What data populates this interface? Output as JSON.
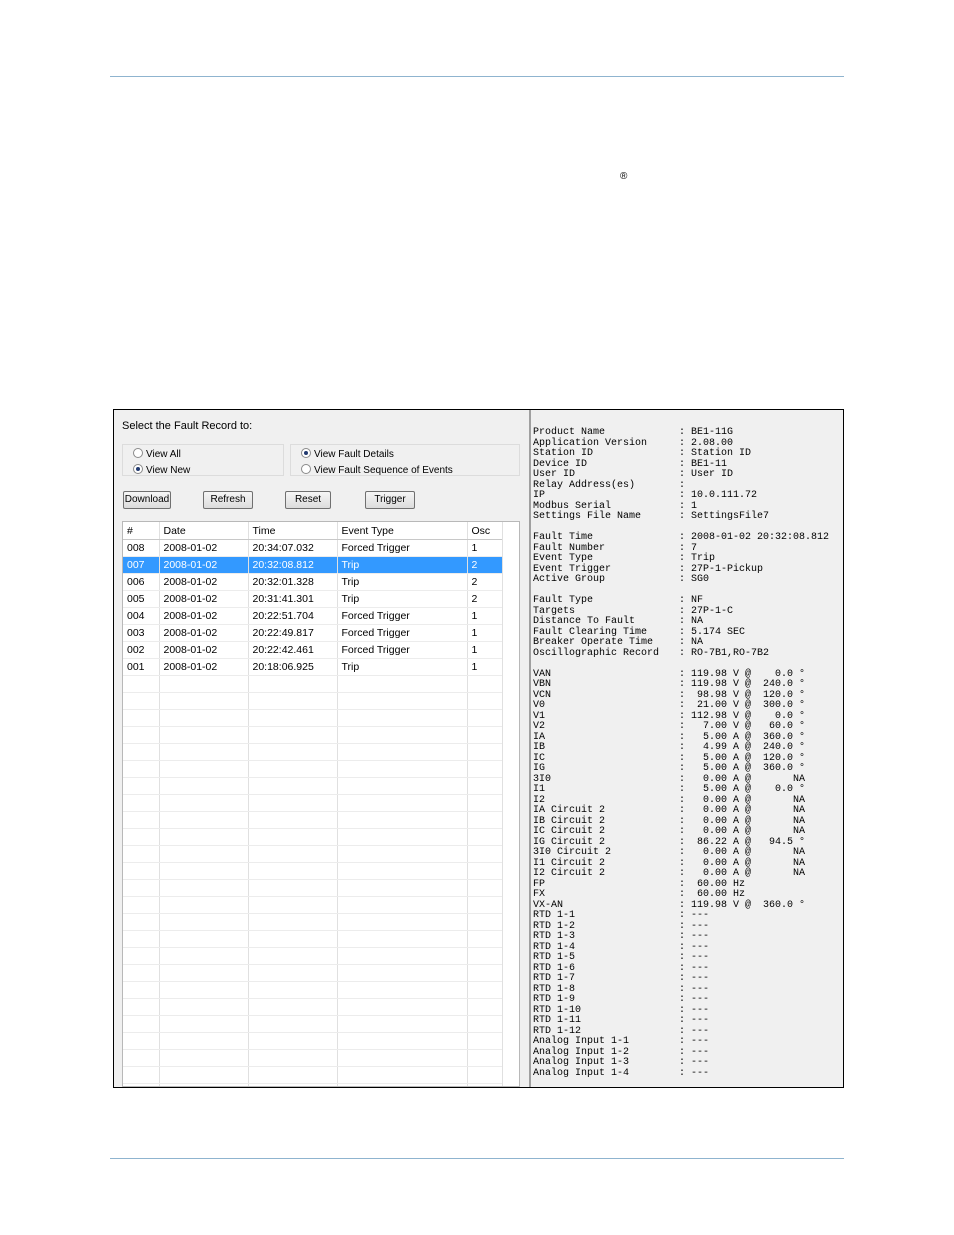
{
  "page": {
    "registered_mark": "®"
  },
  "dialog": {
    "prompt": "Select the Fault Record to:",
    "view_options": [
      {
        "label": "View All",
        "selected": false
      },
      {
        "label": "View New",
        "selected": true
      }
    ],
    "detail_options": [
      {
        "label": "View Fault Details",
        "selected": true
      },
      {
        "label": "View Fault Sequence of Events",
        "selected": false
      }
    ],
    "buttons": {
      "download": "Download",
      "refresh": "Refresh",
      "reset": "Reset",
      "trigger": "Trigger"
    },
    "table": {
      "headers": [
        "#",
        "Date",
        "Time",
        "Event Type",
        "Osc"
      ],
      "rows": [
        [
          "008",
          "2008-01-02",
          "20:34:07.032",
          "Forced Trigger",
          "1"
        ],
        [
          "007",
          "2008-01-02",
          "20:32:08.812",
          "Trip",
          "2"
        ],
        [
          "006",
          "2008-01-02",
          "20:32:01.328",
          "Trip",
          "2"
        ],
        [
          "005",
          "2008-01-02",
          "20:31:41.301",
          "Trip",
          "2"
        ],
        [
          "004",
          "2008-01-02",
          "20:22:51.704",
          "Forced Trigger",
          "1"
        ],
        [
          "003",
          "2008-01-02",
          "20:22:49.817",
          "Forced Trigger",
          "1"
        ],
        [
          "002",
          "2008-01-02",
          "20:22:42.461",
          "Forced Trigger",
          "1"
        ],
        [
          "001",
          "2008-01-02",
          "20:18:06.925",
          "Trip",
          "1"
        ]
      ],
      "selected_row": "007"
    }
  },
  "report": {
    "sections": [
      [
        [
          "Product Name",
          ": BE1-11G"
        ],
        [
          "Application Version",
          ": 2.08.00"
        ],
        [
          "Station ID",
          ": Station ID"
        ],
        [
          "Device ID",
          ": BE1-11"
        ],
        [
          "User ID",
          ": User ID"
        ],
        [
          "Relay Address(es)",
          ":"
        ],
        [
          "IP",
          ": 10.0.111.72"
        ],
        [
          "Modbus Serial",
          ": 1"
        ],
        [
          "Settings File Name",
          ": SettingsFile7"
        ]
      ],
      [
        [
          "Fault Time",
          ": 2008-01-02 20:32:08.812"
        ],
        [
          "Fault Number",
          ": 7"
        ],
        [
          "Event Type",
          ": Trip"
        ],
        [
          "Event Trigger",
          ": 27P-1-Pickup"
        ],
        [
          "Active Group",
          ": SG0"
        ]
      ],
      [
        [
          "Fault Type",
          ": NF"
        ],
        [
          "Targets",
          ": 27P-1-C"
        ],
        [
          "Distance To Fault",
          ": NA"
        ],
        [
          "Fault Clearing Time",
          ": 5.174 SEC"
        ],
        [
          "Breaker Operate Time",
          ": NA"
        ],
        [
          "Oscillographic Record",
          ": RO-7B1,RO-7B2"
        ]
      ],
      [
        [
          "VAN",
          ": 119.98 V @    0.0 °"
        ],
        [
          "VBN",
          ": 119.98 V @  240.0 °"
        ],
        [
          "VCN",
          ":  98.98 V @  120.0 °"
        ],
        [
          "V0",
          ":  21.00 V @  300.0 °"
        ],
        [
          "V1",
          ": 112.98 V @    0.0 °"
        ],
        [
          "V2",
          ":   7.00 V @   60.0 °"
        ],
        [
          "IA",
          ":   5.00 A @  360.0 °"
        ],
        [
          "IB",
          ":   4.99 A @  240.0 °"
        ],
        [
          "IC",
          ":   5.00 A @  120.0 °"
        ],
        [
          "IG",
          ":   5.00 A @  360.0 °"
        ],
        [
          "3I0",
          ":   0.00 A @       NA"
        ],
        [
          "I1",
          ":   5.00 A @    0.0 °"
        ],
        [
          "I2",
          ":   0.00 A @       NA"
        ],
        [
          "IA Circuit 2",
          ":   0.00 A @       NA"
        ],
        [
          "IB Circuit 2",
          ":   0.00 A @       NA"
        ],
        [
          "IC Circuit 2",
          ":   0.00 A @       NA"
        ],
        [
          "IG Circuit 2",
          ":  86.22 A @   94.5 °"
        ],
        [
          "3I0 Circuit 2",
          ":   0.00 A @       NA"
        ],
        [
          "I1 Circuit 2",
          ":   0.00 A @       NA"
        ],
        [
          "I2 Circuit 2",
          ":   0.00 A @       NA"
        ],
        [
          "FP",
          ":  60.00 Hz"
        ],
        [
          "FX",
          ":  60.00 Hz"
        ],
        [
          "VX-AN",
          ": 119.98 V @  360.0 °"
        ],
        [
          "RTD 1-1",
          ": ---"
        ],
        [
          "RTD 1-2",
          ": ---"
        ],
        [
          "RTD 1-3",
          ": ---"
        ],
        [
          "RTD 1-4",
          ": ---"
        ],
        [
          "RTD 1-5",
          ": ---"
        ],
        [
          "RTD 1-6",
          ": ---"
        ],
        [
          "RTD 1-7",
          ": ---"
        ],
        [
          "RTD 1-8",
          ": ---"
        ],
        [
          "RTD 1-9",
          ": ---"
        ],
        [
          "RTD 1-10",
          ": ---"
        ],
        [
          "RTD 1-11",
          ": ---"
        ],
        [
          "RTD 1-12",
          ": ---"
        ],
        [
          "Analog Input 1-1",
          ": ---"
        ],
        [
          "Analog Input 1-2",
          ": ---"
        ],
        [
          "Analog Input 1-3",
          ": ---"
        ],
        [
          "Analog Input 1-4",
          ": ---"
        ]
      ]
    ]
  }
}
